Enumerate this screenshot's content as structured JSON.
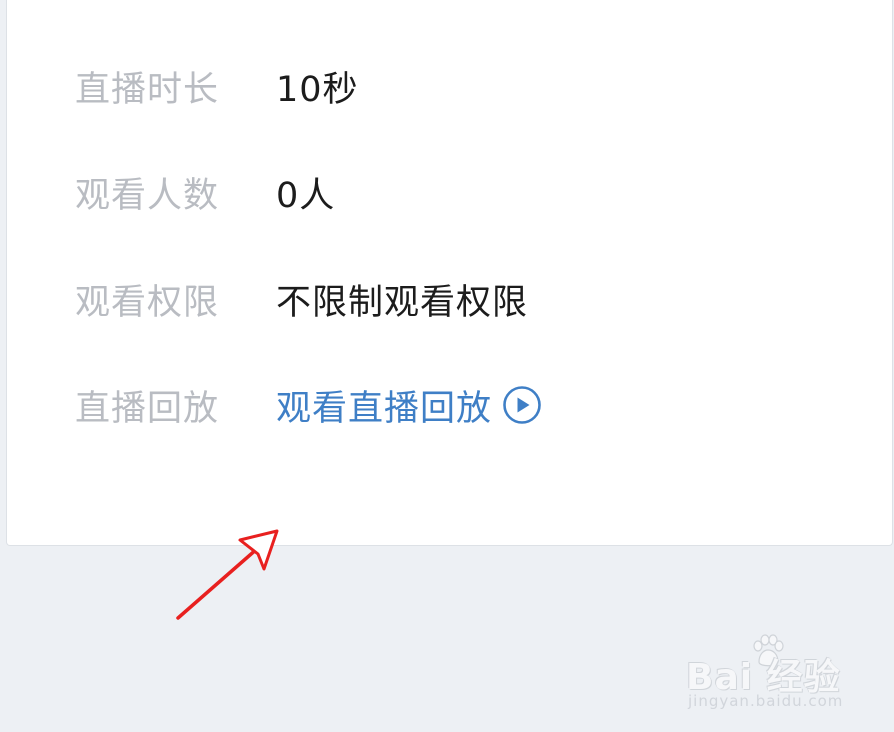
{
  "details": [
    {
      "label": "直播时长",
      "value": "10秒"
    },
    {
      "label": "观看人数",
      "value": "0人"
    },
    {
      "label": "观看权限",
      "value": "不限制观看权限"
    },
    {
      "label": "直播回放",
      "value": "观看直播回放"
    }
  ],
  "watermark": {
    "logo": "Bai 经验",
    "url": "jingyan.baidu.com"
  },
  "colors": {
    "background": "#edf0f4",
    "card": "#ffffff",
    "label": "#b9bcc2",
    "value": "#1c1c1c",
    "link": "#3f7fc6",
    "annotation_arrow": "#e8201f"
  },
  "icons": {
    "replay": "play-circle-icon",
    "annotation": "red-arrow"
  }
}
